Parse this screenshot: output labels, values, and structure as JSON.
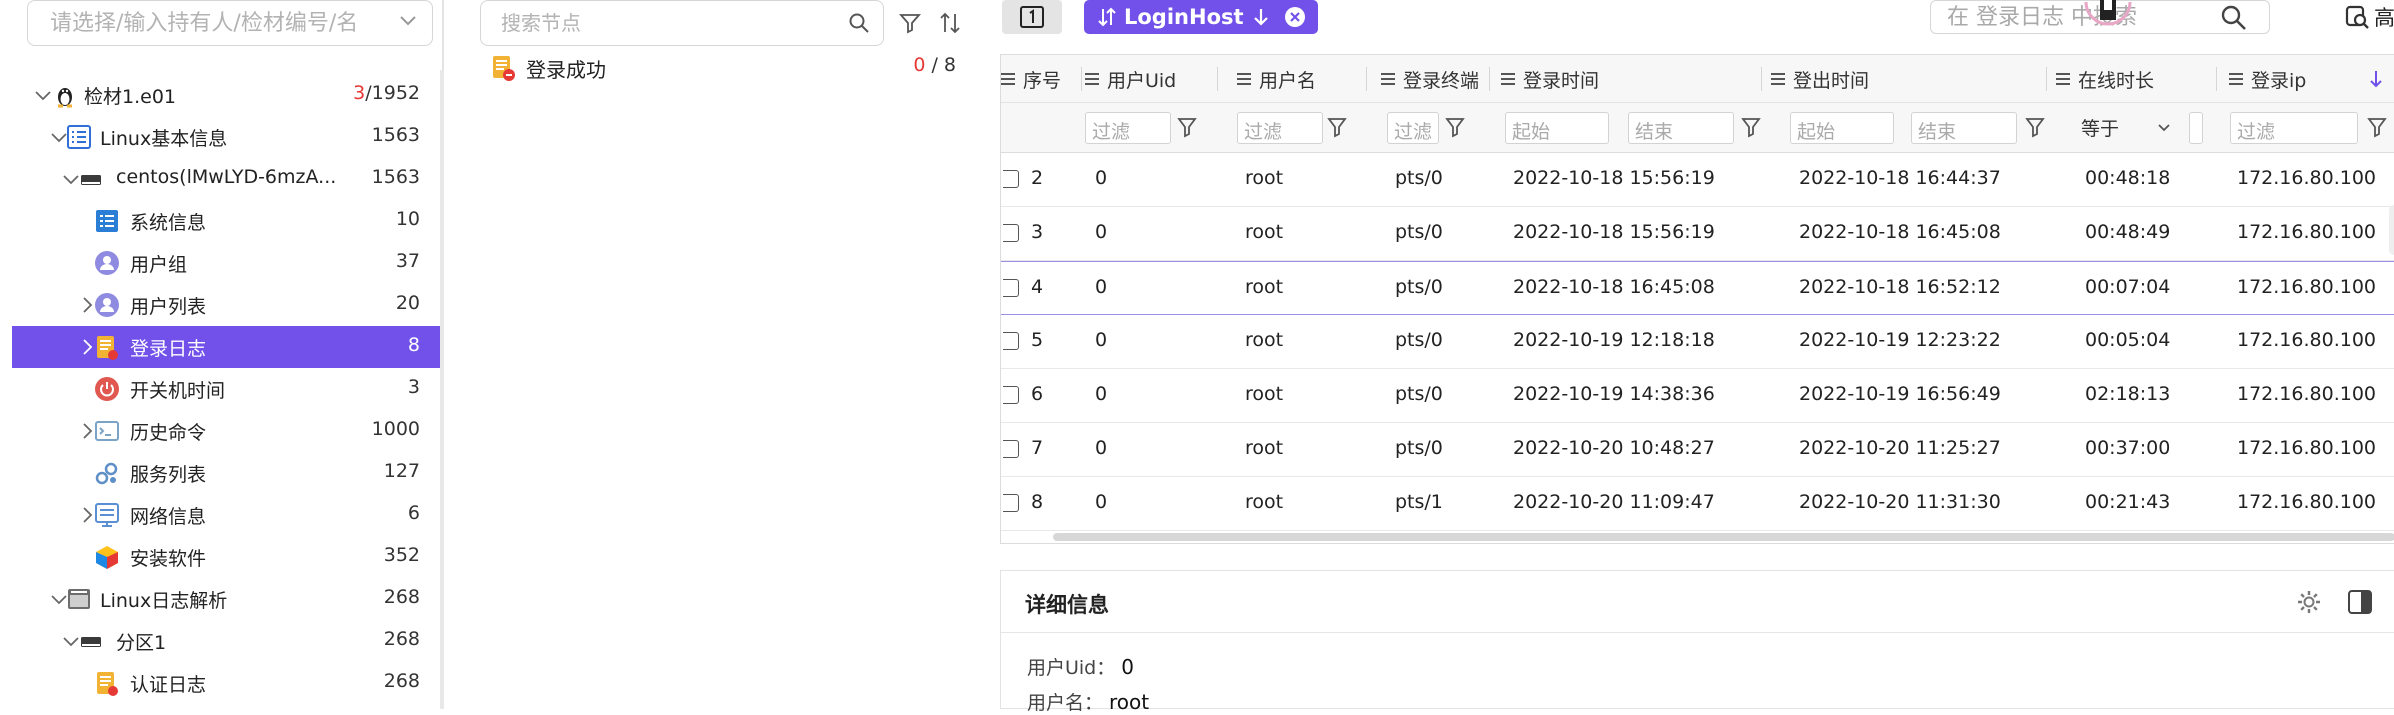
{
  "left": {
    "owner_placeholder": "请选择/输入持有人/检材编号/名",
    "tree": [
      {
        "label": "检材1.e01",
        "count_red": "3",
        "count_rest": "/1952",
        "icon": "linux-penguin-icon",
        "depth": 0,
        "arrow": "down"
      },
      {
        "label": "Linux基本信息",
        "count": "1563",
        "icon": "list-icon",
        "depth": 1,
        "arrow": "down"
      },
      {
        "label": "centos(lMwLYD-6mzA...",
        "count": "1563",
        "icon": "disk-icon",
        "depth": 2,
        "arrow": "down"
      },
      {
        "label": "系统信息",
        "count": "10",
        "icon": "system-info-icon",
        "depth": 3,
        "arrow": "none"
      },
      {
        "label": "用户组",
        "count": "37",
        "icon": "user-group-icon",
        "depth": 3,
        "arrow": "none"
      },
      {
        "label": "用户列表",
        "count": "20",
        "icon": "user-list-icon",
        "depth": 3,
        "arrow": "right"
      },
      {
        "label": "登录日志",
        "count": "8",
        "icon": "login-log-icon",
        "depth": 3,
        "arrow": "right",
        "selected": true
      },
      {
        "label": "开关机时间",
        "count": "3",
        "icon": "power-icon",
        "depth": 3,
        "arrow": "none"
      },
      {
        "label": "历史命令",
        "count": "1000",
        "icon": "terminal-icon",
        "depth": 3,
        "arrow": "right"
      },
      {
        "label": "服务列表",
        "count": "127",
        "icon": "services-icon",
        "depth": 3,
        "arrow": "none"
      },
      {
        "label": "网络信息",
        "count": "6",
        "icon": "network-icon",
        "depth": 3,
        "arrow": "right"
      },
      {
        "label": "安装软件",
        "count": "352",
        "icon": "package-icon",
        "depth": 3,
        "arrow": "none"
      },
      {
        "label": "Linux日志解析",
        "count": "268",
        "icon": "log-folder-icon",
        "depth": 1,
        "arrow": "down"
      },
      {
        "label": "分区1",
        "count": "268",
        "icon": "disk-icon",
        "depth": 2,
        "arrow": "down"
      },
      {
        "label": "认证日志",
        "count": "268",
        "icon": "auth-log-icon",
        "depth": 3,
        "arrow": "none"
      }
    ]
  },
  "middle": {
    "search_placeholder": "搜索节点",
    "node": {
      "label": "登录成功",
      "count_red": "0",
      "count_rest": " / 8"
    }
  },
  "right": {
    "tag_label": "LoginHost",
    "log_search_placeholder": "在 登录日志 中搜索",
    "advanced_label": "高",
    "columns": [
      "序号",
      "用户Uid",
      "用户名",
      "登录终端",
      "登录时间",
      "登出时间",
      "在线时长",
      "登录ip"
    ],
    "filters": {
      "uid": "过滤",
      "name": "过滤",
      "tty": "过滤",
      "login_start": "起始",
      "login_end": "结束",
      "logout_start": "起始",
      "logout_end": "结束",
      "duration_op": "等于",
      "ip": "过滤"
    },
    "rows": [
      {
        "seq": "2",
        "uid": "0",
        "user": "root",
        "tty": "pts/0",
        "login": "2022-10-18 15:56:19",
        "logout": "2022-10-18 16:44:37",
        "dur": "00:48:18",
        "ip": "172.16.80.100"
      },
      {
        "seq": "3",
        "uid": "0",
        "user": "root",
        "tty": "pts/0",
        "login": "2022-10-18 15:56:19",
        "logout": "2022-10-18 16:45:08",
        "dur": "00:48:49",
        "ip": "172.16.80.100"
      },
      {
        "seq": "4",
        "uid": "0",
        "user": "root",
        "tty": "pts/0",
        "login": "2022-10-18 16:45:08",
        "logout": "2022-10-18 16:52:12",
        "dur": "00:07:04",
        "ip": "172.16.80.100"
      },
      {
        "seq": "5",
        "uid": "0",
        "user": "root",
        "tty": "pts/0",
        "login": "2022-10-19 12:18:18",
        "logout": "2022-10-19 12:23:22",
        "dur": "00:05:04",
        "ip": "172.16.80.100"
      },
      {
        "seq": "6",
        "uid": "0",
        "user": "root",
        "tty": "pts/0",
        "login": "2022-10-19 14:38:36",
        "logout": "2022-10-19 16:56:49",
        "dur": "02:18:13",
        "ip": "172.16.80.100"
      },
      {
        "seq": "7",
        "uid": "0",
        "user": "root",
        "tty": "pts/0",
        "login": "2022-10-20 10:48:27",
        "logout": "2022-10-20 11:25:27",
        "dur": "00:37:00",
        "ip": "172.16.80.100"
      },
      {
        "seq": "8",
        "uid": "0",
        "user": "root",
        "tty": "pts/1",
        "login": "2022-10-20 11:09:47",
        "logout": "2022-10-20 11:31:30",
        "dur": "00:21:43",
        "ip": "172.16.80.100"
      }
    ],
    "highlighted_row": "4",
    "detail": {
      "title": "详细信息",
      "fields": [
        {
          "key": "用户Uid：",
          "value": "0"
        },
        {
          "key": "用户名：",
          "value": "root"
        }
      ]
    }
  },
  "colors": {
    "accent": "#7151e9",
    "count_red": "#e53935"
  }
}
